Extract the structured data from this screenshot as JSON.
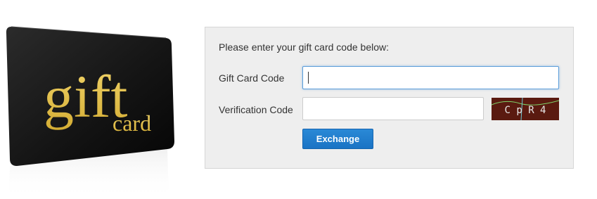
{
  "card": {
    "main_word": "gift",
    "sub_word": "card"
  },
  "form": {
    "instruction": "Please enter your gift card code below:",
    "gift_code_label": "Gift Card Code",
    "gift_code_value": "",
    "verification_label": "Verification Code",
    "verification_value": "",
    "captcha_text": "C p R 4",
    "exchange_label": "Exchange"
  },
  "colors": {
    "panel_bg": "#eeeeee",
    "button_blue": "#1a73c4",
    "card_gold": "#e6c34a",
    "captcha_bg": "#5a1a10"
  }
}
